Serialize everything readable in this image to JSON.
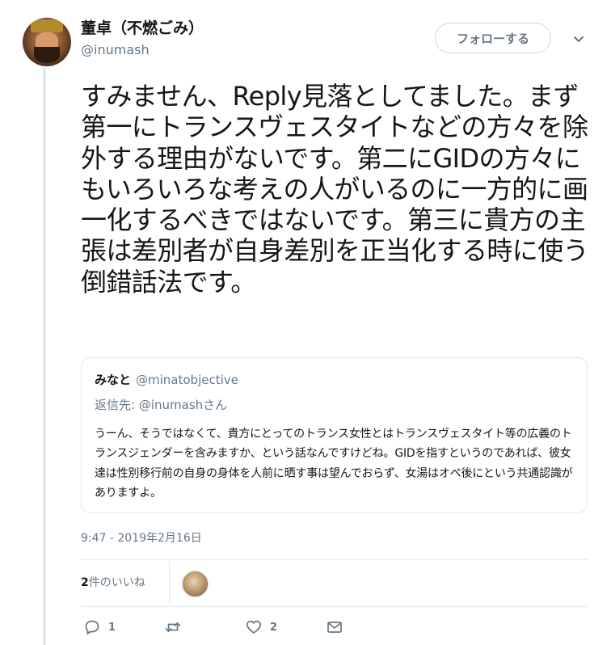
{
  "author": {
    "name": "董卓（不燃ごみ）",
    "handle": "@inumash"
  },
  "header": {
    "follow_label": "フォローする",
    "menu_icon": "chevron-down-icon"
  },
  "tweet": {
    "text": "すみません、Reply見落としてました。まず第一にトランスヴェスタイトなどの方々を除外する理由がないです。第二にGIDの方々にもいろいろな考えの人がいるのに一方的に画一化するべきではないです。第三に貴方の主張は差別者が自身差別を正当化する時に使う倒錯話法です。",
    "timestamp": "9:47 - 2019年2月16日"
  },
  "quoted_tweet": {
    "name": "みなと",
    "handle": "@minatobjective",
    "reply_to_prefix": "返信先: ",
    "reply_to_handle": "@inumashさん",
    "text": "うーん、そうではなくて、貴方にとってのトランス女性とはトランスヴェスタイト等の広義のトランスジェンダーを含みますか、という話なんですけどね。GIDを指すというのであれば、彼女達は性別移行前の自身の身体を人前に晒す事は望んでおらず、女湯はオペ後にという共通認識がありますよ。"
  },
  "likes": {
    "count": "2",
    "label": "件のいいね"
  },
  "actions": {
    "reply_count": "1",
    "retweet_count": "",
    "like_count": "2"
  },
  "colors": {
    "text": "#14171a",
    "secondary": "#657786",
    "border": "#e1e8ed"
  }
}
